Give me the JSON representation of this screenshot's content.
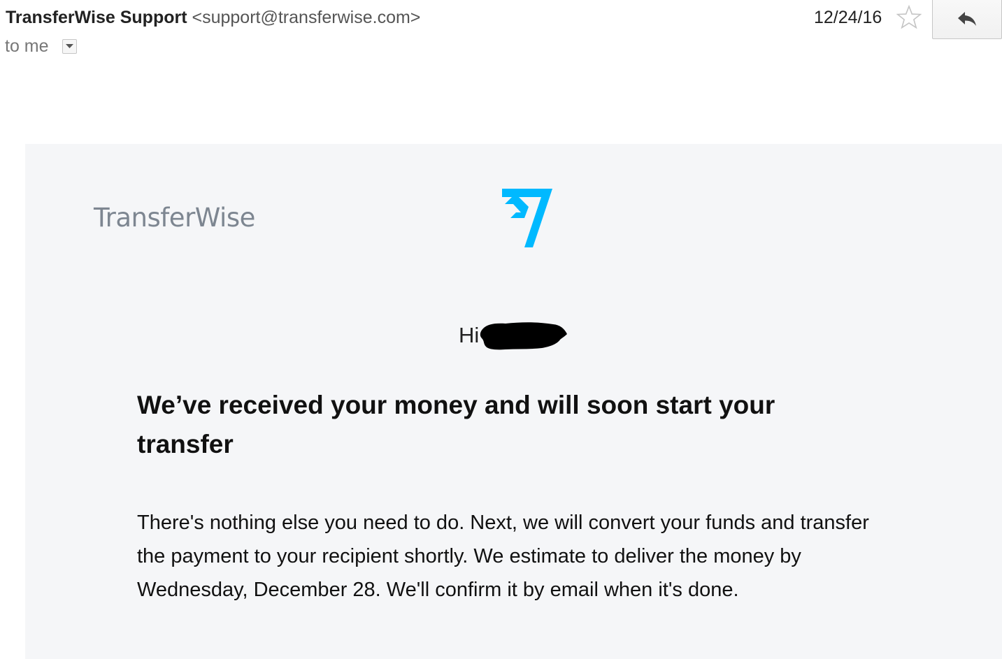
{
  "header": {
    "sender_name": "TransferWise Support",
    "sender_email": "<support@transferwise.com>",
    "recipient": "to me",
    "date": "12/24/16",
    "icons": {
      "details": "chevron-down-icon",
      "star": "star-outline-icon",
      "reply": "reply-arrow-icon"
    }
  },
  "email": {
    "logo_wordmark": "TransferWise",
    "logo_icon": "transferwise-flag-logo",
    "greeting": "Hi",
    "headline": "We’ve received your money and will soon start your transfer",
    "body": "There's nothing else you need to do. Next, we will convert your funds and transfer the payment to your recipient shortly. We estimate to deliver the money by Wednesday, December 28. We'll confirm it by email when it's done."
  },
  "colors": {
    "brand_blue": "#00b9ff",
    "card_background": "#f5f6f8",
    "wordmark_gray": "#7d8691"
  }
}
